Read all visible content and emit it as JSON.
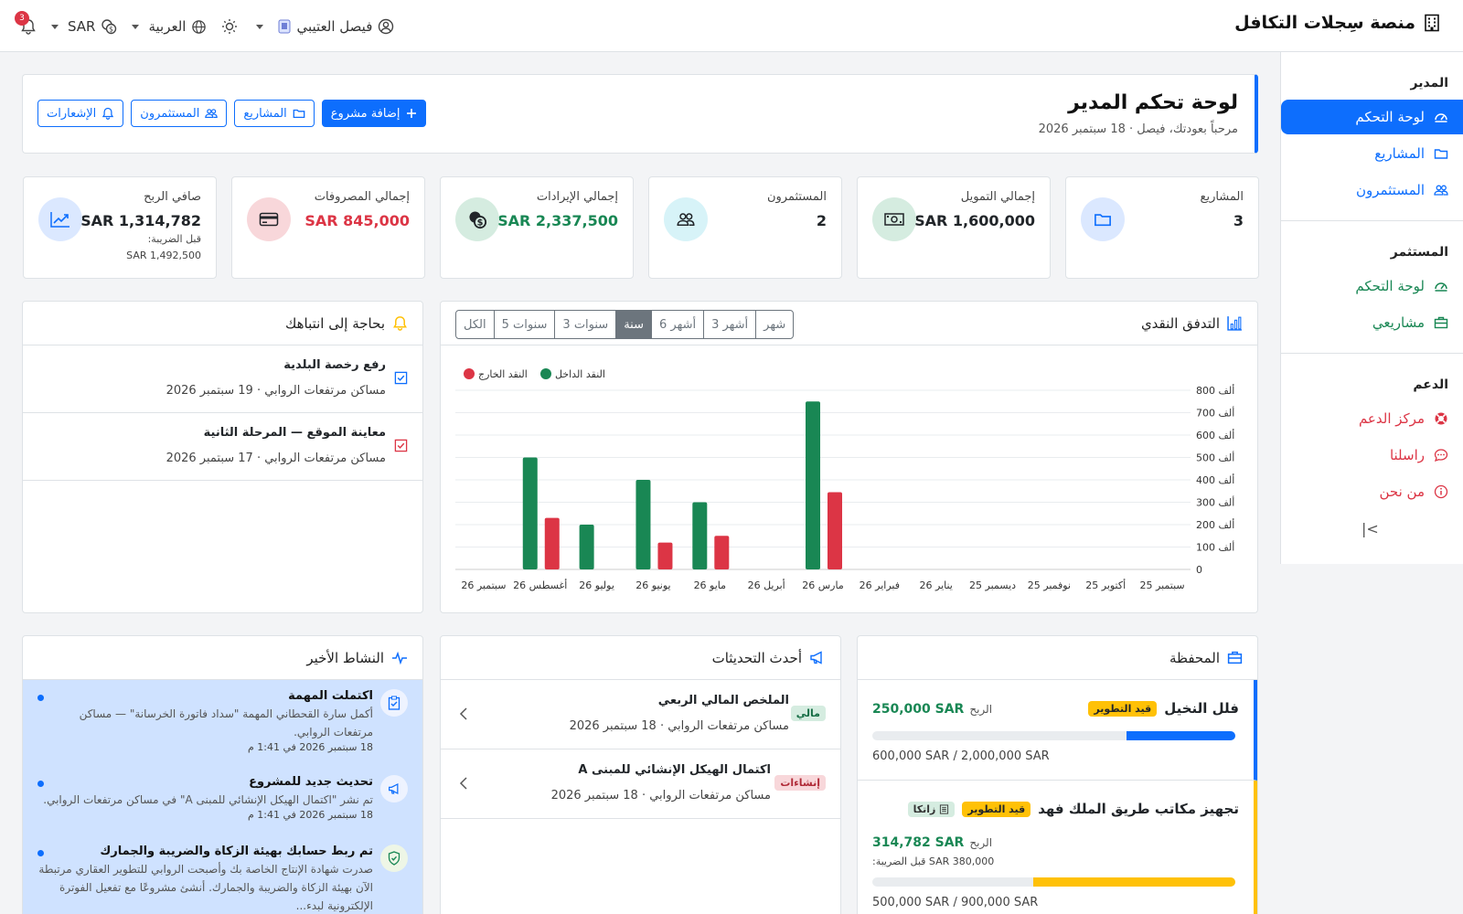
{
  "app": {
    "brand": "منصة سِجلات التكافل"
  },
  "topbar": {
    "user_name": "فيصل العتيبي",
    "language": "العربية",
    "currency": "SAR",
    "notifications_count": "3"
  },
  "sidebar": {
    "sections": [
      {
        "title": "المدير",
        "items": [
          {
            "label": "لوحة التحكم",
            "icon": "dashboard-icon",
            "style": "active"
          },
          {
            "label": "المشاريع",
            "icon": "folder-icon",
            "style": "blue"
          },
          {
            "label": "المستثمرون",
            "icon": "people-icon",
            "style": "blue"
          }
        ]
      },
      {
        "title": "المستثمر",
        "items": [
          {
            "label": "لوحة التحكم",
            "icon": "dashboard-icon",
            "style": "green"
          },
          {
            "label": "مشاريعي",
            "icon": "briefcase-icon",
            "style": "green"
          }
        ]
      },
      {
        "title": "الدعم",
        "items": [
          {
            "label": "مركز الدعم",
            "icon": "lifebuoy-icon",
            "style": "red"
          },
          {
            "label": "راسلنا",
            "icon": "chat-icon",
            "style": "red"
          },
          {
            "label": "من نحن",
            "icon": "info-icon",
            "style": "red"
          }
        ]
      }
    ],
    "collapse_label": "|<"
  },
  "header": {
    "title": "لوحة تحكم المدير",
    "subtitle": "مرحباً بعودتك، فيصل · 18 سبتمبر 2026",
    "buttons": {
      "add_project": "إضافة مشروع",
      "projects": "المشاريع",
      "investors": "المستثمرون",
      "notifications": "الإشعارات"
    }
  },
  "stats": [
    {
      "label": "المشاريع",
      "value": "3",
      "icon": "folder-icon",
      "value_color": "#212529",
      "circle_bg": "#dbe8ff",
      "icon_color": "#0d6efd"
    },
    {
      "label": "إجمالي التمويل",
      "value": "1,600,000 SAR",
      "icon": "cash-icon",
      "value_color": "#212529",
      "circle_bg": "#d5ece0",
      "icon_color": "#212529"
    },
    {
      "label": "المستثمرون",
      "value": "2",
      "icon": "people-icon",
      "value_color": "#212529",
      "circle_bg": "#d7f3f8",
      "icon_color": "#212529"
    },
    {
      "label": "إجمالي الإيرادات",
      "value": "2,337,500 SAR",
      "icon": "coins-icon",
      "value_color": "#198754",
      "circle_bg": "#d5ece0",
      "icon_color": "#212529"
    },
    {
      "label": "إجمالي المصروفات",
      "value": "845,000 SAR",
      "icon": "credit-card-icon",
      "value_color": "#dc3545",
      "circle_bg": "#f8d7da",
      "icon_color": "#212529"
    },
    {
      "label": "صافي الربح",
      "value": "1,314,782 SAR",
      "icon": "trend-icon",
      "value_color": "#212529",
      "circle_bg": "#dbe8ff",
      "icon_color": "#0d6efd",
      "sub_label": "قبل الضريبة:",
      "sub_value": "1,492,500 SAR"
    }
  ],
  "cashflow": {
    "title": "التدفق النقدي",
    "ranges": [
      "شهر",
      "3 أشهر",
      "6 أشهر",
      "سنة",
      "3 سنوات",
      "5 سنوات",
      "الكل"
    ],
    "selected_range": "سنة"
  },
  "chart_data": {
    "type": "bar",
    "categories": [
      "سبتمبر 25",
      "أكتوبر 25",
      "نوفمبر 25",
      "ديسمبر 25",
      "يناير 26",
      "فبراير 26",
      "مارس 26",
      "أبريل 26",
      "مايو 26",
      "يونيو 26",
      "يوليو 26",
      "أغسطس 26",
      "سبتمبر 26"
    ],
    "series": [
      {
        "name": "النقد الداخل",
        "color": "#198754",
        "values": [
          0,
          0,
          0,
          0,
          0,
          0,
          750000,
          0,
          300000,
          400000,
          200000,
          500000,
          0
        ]
      },
      {
        "name": "النقد الخارج",
        "color": "#dc3545",
        "values": [
          0,
          0,
          0,
          0,
          0,
          0,
          345000,
          0,
          150000,
          120000,
          0,
          230000,
          0
        ]
      }
    ],
    "yticks": [
      "0",
      "100 ألف",
      "200 ألف",
      "300 ألف",
      "400 ألف",
      "500 ألف",
      "600 ألف",
      "700 ألف",
      "800 ألف"
    ],
    "ylim": [
      0,
      800000
    ],
    "grid": true,
    "legend_position": "top-left"
  },
  "attention": {
    "title": "بحاجة إلى انتباهك",
    "items": [
      {
        "title": "رفع رخصة البلدية",
        "sub": "مساكن مرتفعات الروابي · 19 سبتمبر 2026",
        "color": "#0d6efd"
      },
      {
        "title": "معاينة الموقع — المرحلة الثانية",
        "sub": "مساكن مرتفعات الروابي · 17 سبتمبر 2026",
        "color": "#dc3545"
      }
    ]
  },
  "portfolio": {
    "title": "المحفظة",
    "items": [
      {
        "name": "فلل النخيل",
        "status": "قيد التطوير",
        "profit_label": "الربح",
        "profit": "250,000 SAR",
        "amounts": "600,000 SAR / 2,000,000 SAR",
        "progress": 0.3,
        "accent": "#0d6efd"
      },
      {
        "name": "تجهيز مكاتب طريق الملك فهد",
        "status": "قيد التطوير",
        "zatca": "زاتكا",
        "profit_label": "الربح",
        "profit": "314,782 SAR",
        "pretax": "380,000 SAR قبل الضريبة:",
        "amounts": "500,000 SAR / 900,000 SAR",
        "progress": 0.556,
        "accent": "#ffc107"
      }
    ]
  },
  "updates": {
    "title": "أحدث التحديثات",
    "items": [
      {
        "title": "الملخص المالي الربعي",
        "sub": "مساكن مرتفعات الروابي · 18 سبتمبر 2026",
        "tag": "مالي",
        "tag_bg": "#d5ece0",
        "tag_color": "#146c43"
      },
      {
        "title": "اكتمال الهيكل الإنشائي للمبنى A",
        "sub": "مساكن مرتفعات الروابي · 18 سبتمبر 2026",
        "tag": "إنشاءات",
        "tag_bg": "#f8d7da",
        "tag_color": "#b02a37"
      }
    ]
  },
  "activity": {
    "title": "النشاط الأخير",
    "items": [
      {
        "title": "اكتملت المهمة",
        "desc": "أكمل سارة القحطاني المهمة \"سداد فاتورة الخرسانة\" — مساكن مرتفعات الروابي.",
        "time": "18 سبتمبر 2026 في 1:41 م",
        "icon": "clipboard-check-icon"
      },
      {
        "title": "تحديث جديد للمشروع",
        "desc": "تم نشر \"اكتمال الهيكل الإنشائي للمبنى A\" في مساكن مرتفعات الروابي.",
        "time": "18 سبتمبر 2026 في 1:41 م",
        "icon": "megaphone-icon"
      },
      {
        "title": "تم ربط حسابك بهيئة الزكاة والضريبة والجمارك",
        "desc": "صدرت شهادة الإنتاج الخاصة بك وأصبحت الروابي للتطوير العقاري مرتبطة الآن بهيئة الزكاة والضريبة والجمارك. أنشئ مشروعًا مع تفعيل الفوترة الإلكترونية لبدء...",
        "time": "",
        "icon": "shield-check-icon"
      }
    ]
  }
}
